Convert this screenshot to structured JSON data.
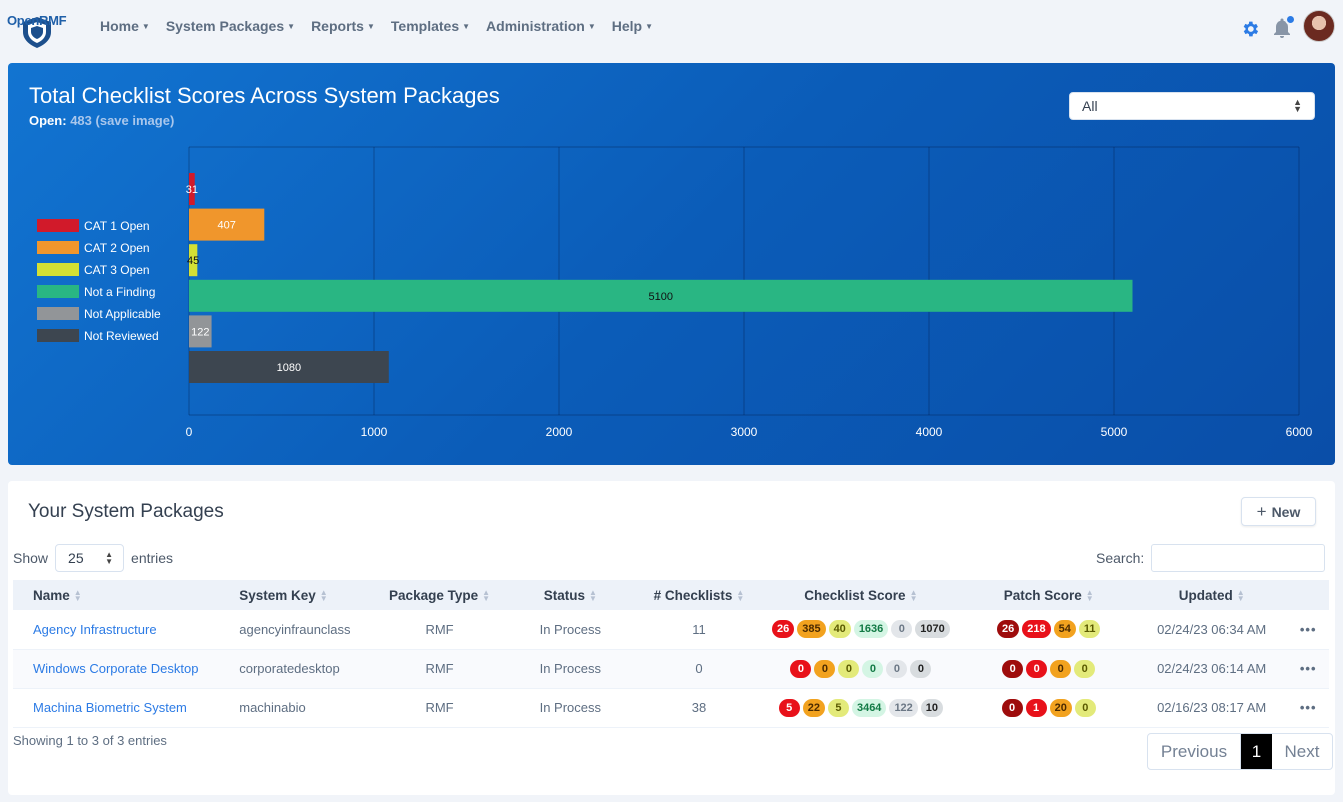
{
  "brand": {
    "logo_text_a": "Open",
    "logo_text_b": "RMF"
  },
  "nav": [
    {
      "label": "Home"
    },
    {
      "label": "System Packages"
    },
    {
      "label": "Reports"
    },
    {
      "label": "Templates"
    },
    {
      "label": "Administration"
    },
    {
      "label": "Help"
    }
  ],
  "colors": {
    "accent": "#2c7be5",
    "chart_bg": "#0b5cb8",
    "cat1": "#d11a2a",
    "cat2": "#f0962c",
    "cat3": "#d4e034",
    "naf": "#29b683",
    "na": "#929598",
    "nr": "#3d4650"
  },
  "icons": {
    "settings": "gear-icon",
    "notifications": "bell-icon",
    "sort": "sort-icon",
    "add": "plus-icon",
    "actions": "ellipsis-icon"
  },
  "chart_header": {
    "title": "Total Checklist Scores Across System Packages",
    "open_label": "Open:",
    "open_count": "483",
    "save_label": "(save image)",
    "filter_value": "All"
  },
  "chart_data": {
    "type": "bar",
    "orientation": "horizontal",
    "categories": [
      "CAT 1 Open",
      "CAT 2 Open",
      "CAT 3 Open",
      "Not a Finding",
      "Not Applicable",
      "Not Reviewed"
    ],
    "values": [
      31,
      407,
      45,
      5100,
      122,
      1080
    ],
    "colors": [
      "#d11a2a",
      "#f0962c",
      "#d4e034",
      "#29b683",
      "#929598",
      "#3d4650"
    ],
    "value_labels": [
      "31",
      "407",
      "45",
      "5100",
      "122",
      "1080"
    ],
    "xlim": [
      0,
      6000
    ],
    "xticks": [
      "0",
      "1000",
      "2000",
      "3000",
      "4000",
      "5000",
      "6000"
    ],
    "legend_position": "left",
    "grid": true
  },
  "packages_card": {
    "title": "Your System Packages",
    "new_label": "New",
    "show_label": "Show",
    "page_length": "25",
    "entries_label": "entries",
    "search_label": "Search:",
    "columns": [
      "Name",
      "System Key",
      "Package Type",
      "Status",
      "# Checklists",
      "Checklist Score",
      "Patch Score",
      "Updated"
    ],
    "rows": [
      {
        "name": "Agency Infrastructure",
        "key": "agencyinfraunclass",
        "type": "RMF",
        "status": "In Process",
        "checklists": "11",
        "checklist_score": [
          "26",
          "385",
          "40",
          "1636",
          "0",
          "1070"
        ],
        "patch_score": [
          "26",
          "218",
          "54",
          "11"
        ],
        "updated": "02/24/23 06:34 AM",
        "actions": "•••"
      },
      {
        "name": "Windows Corporate Desktop",
        "key": "corporatedesktop",
        "type": "RMF",
        "status": "In Process",
        "checklists": "0",
        "checklist_score": [
          "0",
          "0",
          "0",
          "0",
          "0",
          "0"
        ],
        "patch_score": [
          "0",
          "0",
          "0",
          "0"
        ],
        "updated": "02/24/23 06:14 AM",
        "actions": "•••"
      },
      {
        "name": "Machina Biometric System",
        "key": "machinabio",
        "type": "RMF",
        "status": "In Process",
        "checklists": "38",
        "checklist_score": [
          "5",
          "22",
          "5",
          "3464",
          "122",
          "10"
        ],
        "patch_score": [
          "0",
          "1",
          "20",
          "0"
        ],
        "updated": "02/16/23 08:17 AM",
        "actions": "•••"
      }
    ],
    "info": "Showing 1 to 3 of 3 entries",
    "pager": {
      "previous": "Previous",
      "current": "1",
      "next": "Next"
    }
  }
}
